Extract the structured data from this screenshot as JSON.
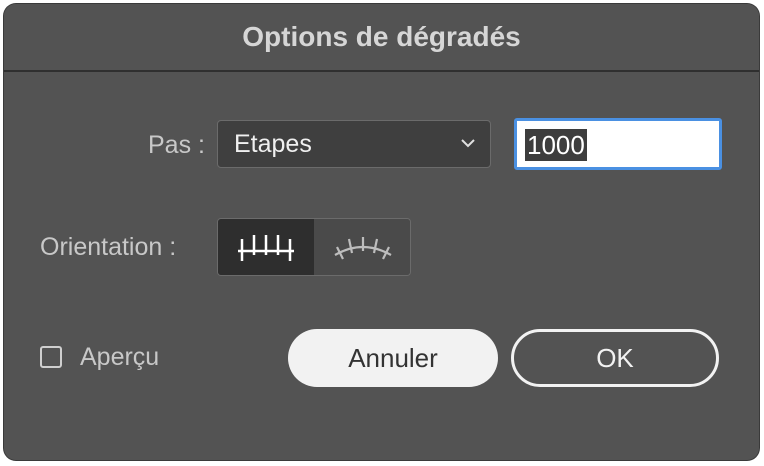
{
  "dialog": {
    "title": "Options de dégradés",
    "pas": {
      "label": "Pas :",
      "selected": "Etapes",
      "value": "1000"
    },
    "orientation": {
      "label": "Orientation :",
      "options": [
        {
          "icon": "align-to-page-icon",
          "active": true
        },
        {
          "icon": "align-to-path-icon",
          "active": false
        }
      ]
    },
    "preview": {
      "label": "Aperçu",
      "checked": false
    },
    "buttons": {
      "cancel": "Annuler",
      "ok": "OK"
    }
  }
}
